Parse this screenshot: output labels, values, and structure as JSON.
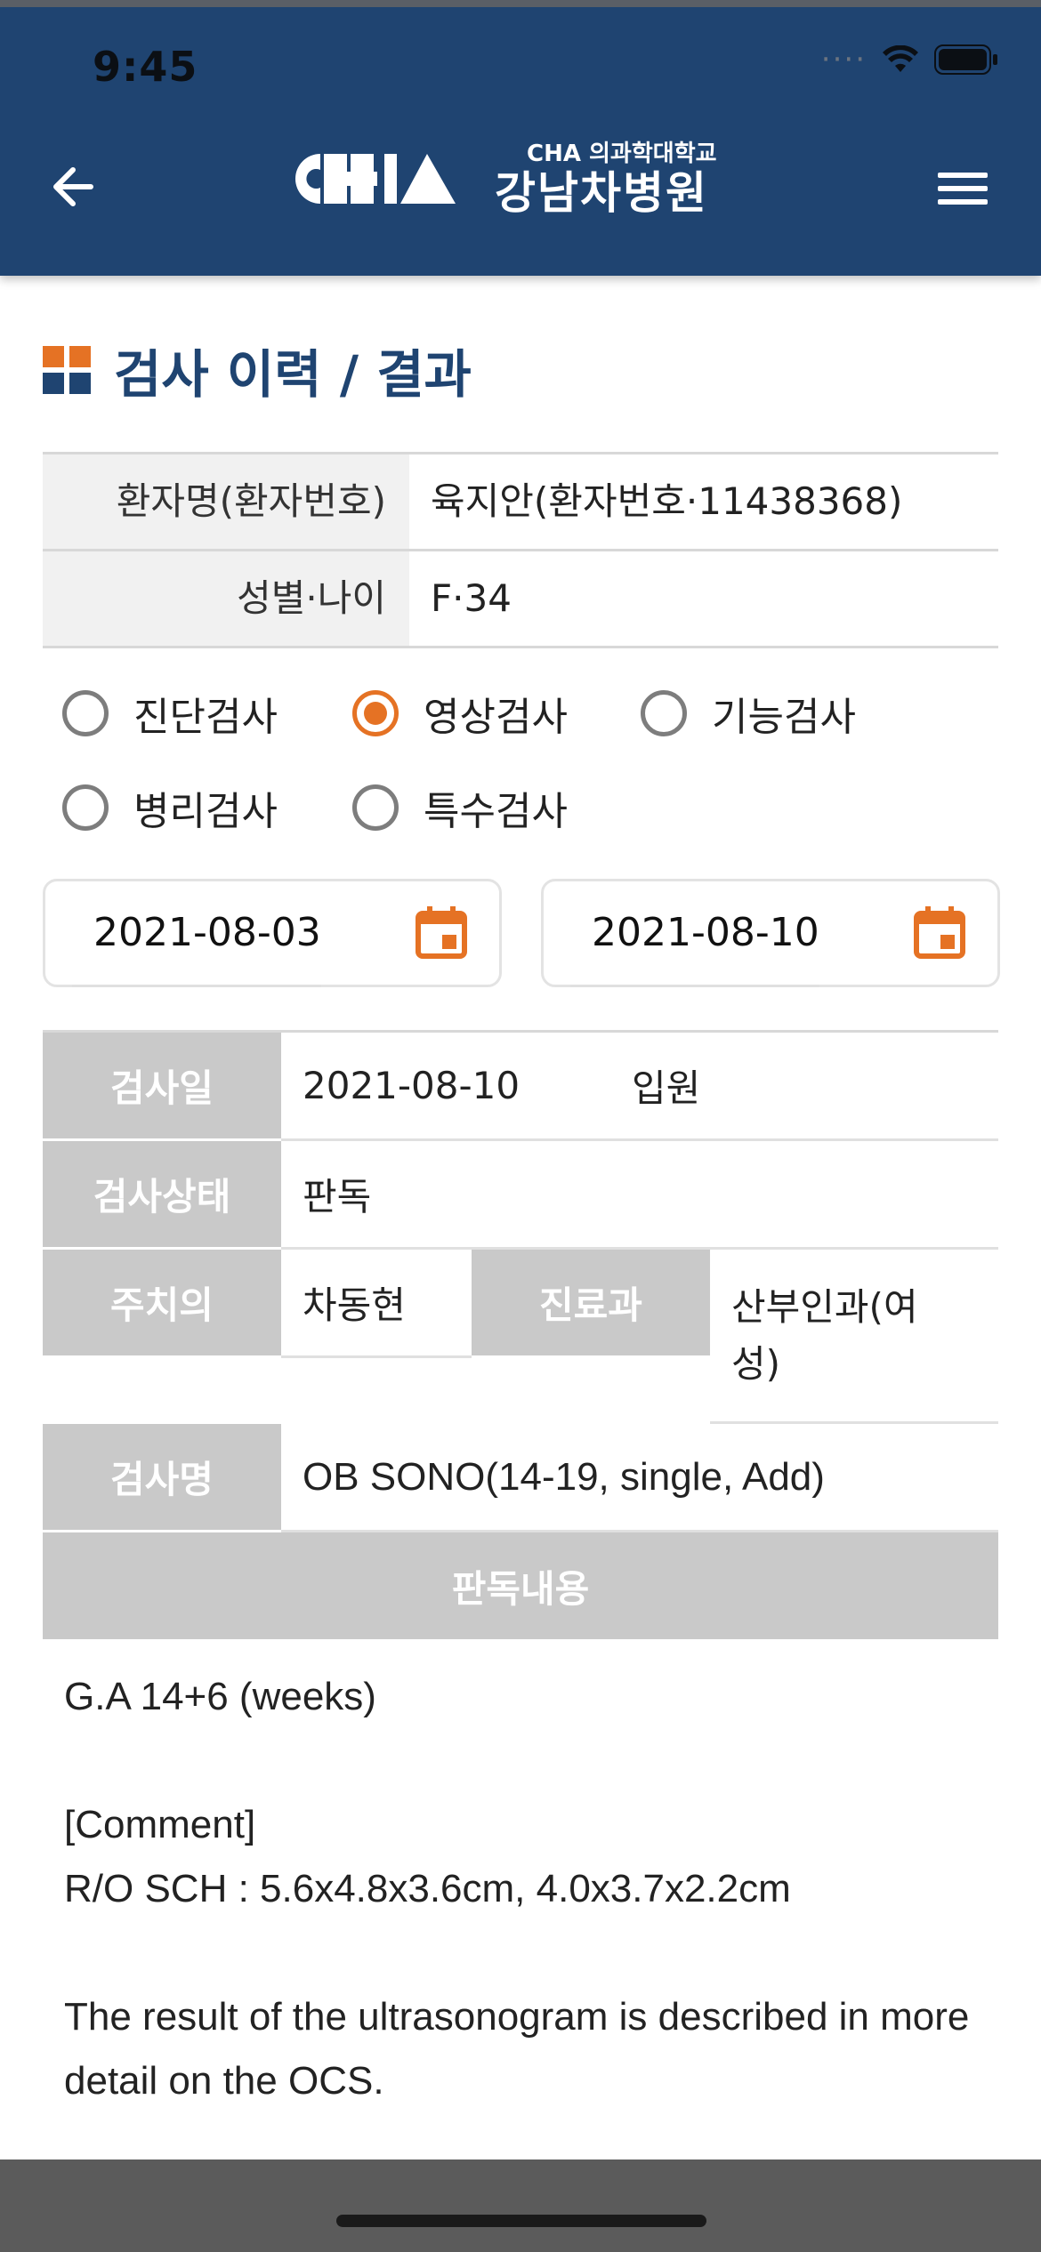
{
  "status_bar": {
    "time": "9:45"
  },
  "header": {
    "logo_sub": "CHA 의과학대학교",
    "logo_main": "강남차병원",
    "back_icon": "arrow-left-icon",
    "menu_icon": "hamburger-menu-icon",
    "color": "#1f4471"
  },
  "page": {
    "title": "검사 이력 / 결과"
  },
  "patient": {
    "name_label": "환자명(환자번호)",
    "name_value": "육지안(환자번호·11438368)",
    "sex_age_label": "성별·나이",
    "sex_age_value": "F·34"
  },
  "test_types": [
    {
      "label": "진단검사",
      "checked": false
    },
    {
      "label": "영상검사",
      "checked": true
    },
    {
      "label": "기능검사",
      "checked": false
    },
    {
      "label": "병리검사",
      "checked": false
    },
    {
      "label": "특수검사",
      "checked": false
    }
  ],
  "date_range": {
    "start": "2021-08-03",
    "end": "2021-08-10"
  },
  "detail": {
    "exam_date_label": "검사일",
    "exam_date_value": "2021-08-10",
    "visit_type": "입원",
    "status_label": "검사상태",
    "status_value": "판독",
    "doctor_label": "주치의",
    "doctor_value": "차동현",
    "dept_label": "진료과",
    "dept_value_line1": "산부인과(여",
    "dept_value_line2": "성)",
    "exam_name_label": "검사명",
    "exam_name_value": "OB SONO(14-19, single, Add)",
    "reading_header": "판독내용"
  },
  "reading": {
    "line1": "G.A 14+6 (weeks)",
    "line2": "[Comment]",
    "line3": "R/O SCH : 5.6x4.8x3.6cm, 4.0x3.7x2.2cm",
    "line4": "The result of the ultrasonogram is described in more detail on the OCS."
  },
  "colors": {
    "accent": "#e57224",
    "brand": "#1f4471",
    "label_bg": "#c9c9c9"
  }
}
